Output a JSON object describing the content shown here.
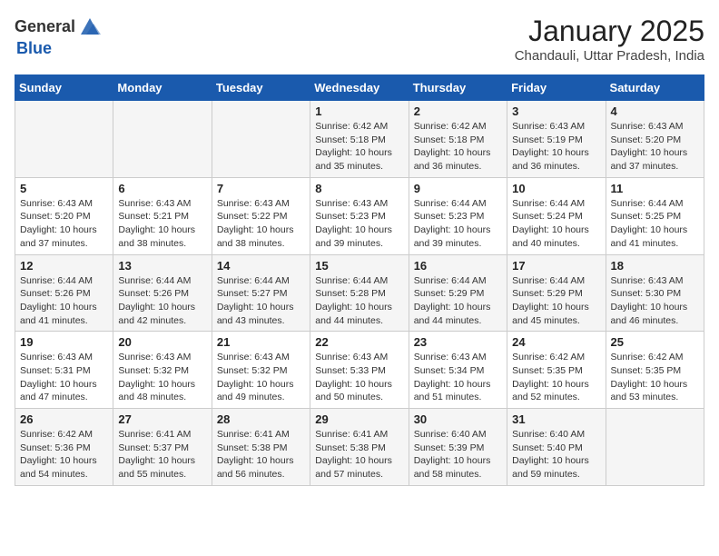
{
  "header": {
    "logo_general": "General",
    "logo_blue": "Blue",
    "month_title": "January 2025",
    "location": "Chandauli, Uttar Pradesh, India"
  },
  "days_of_week": [
    "Sunday",
    "Monday",
    "Tuesday",
    "Wednesday",
    "Thursday",
    "Friday",
    "Saturday"
  ],
  "weeks": [
    [
      {
        "day": "",
        "info": ""
      },
      {
        "day": "",
        "info": ""
      },
      {
        "day": "",
        "info": ""
      },
      {
        "day": "1",
        "info": "Sunrise: 6:42 AM\nSunset: 5:18 PM\nDaylight: 10 hours\nand 35 minutes."
      },
      {
        "day": "2",
        "info": "Sunrise: 6:42 AM\nSunset: 5:18 PM\nDaylight: 10 hours\nand 36 minutes."
      },
      {
        "day": "3",
        "info": "Sunrise: 6:43 AM\nSunset: 5:19 PM\nDaylight: 10 hours\nand 36 minutes."
      },
      {
        "day": "4",
        "info": "Sunrise: 6:43 AM\nSunset: 5:20 PM\nDaylight: 10 hours\nand 37 minutes."
      }
    ],
    [
      {
        "day": "5",
        "info": "Sunrise: 6:43 AM\nSunset: 5:20 PM\nDaylight: 10 hours\nand 37 minutes."
      },
      {
        "day": "6",
        "info": "Sunrise: 6:43 AM\nSunset: 5:21 PM\nDaylight: 10 hours\nand 38 minutes."
      },
      {
        "day": "7",
        "info": "Sunrise: 6:43 AM\nSunset: 5:22 PM\nDaylight: 10 hours\nand 38 minutes."
      },
      {
        "day": "8",
        "info": "Sunrise: 6:43 AM\nSunset: 5:23 PM\nDaylight: 10 hours\nand 39 minutes."
      },
      {
        "day": "9",
        "info": "Sunrise: 6:44 AM\nSunset: 5:23 PM\nDaylight: 10 hours\nand 39 minutes."
      },
      {
        "day": "10",
        "info": "Sunrise: 6:44 AM\nSunset: 5:24 PM\nDaylight: 10 hours\nand 40 minutes."
      },
      {
        "day": "11",
        "info": "Sunrise: 6:44 AM\nSunset: 5:25 PM\nDaylight: 10 hours\nand 41 minutes."
      }
    ],
    [
      {
        "day": "12",
        "info": "Sunrise: 6:44 AM\nSunset: 5:26 PM\nDaylight: 10 hours\nand 41 minutes."
      },
      {
        "day": "13",
        "info": "Sunrise: 6:44 AM\nSunset: 5:26 PM\nDaylight: 10 hours\nand 42 minutes."
      },
      {
        "day": "14",
        "info": "Sunrise: 6:44 AM\nSunset: 5:27 PM\nDaylight: 10 hours\nand 43 minutes."
      },
      {
        "day": "15",
        "info": "Sunrise: 6:44 AM\nSunset: 5:28 PM\nDaylight: 10 hours\nand 44 minutes."
      },
      {
        "day": "16",
        "info": "Sunrise: 6:44 AM\nSunset: 5:29 PM\nDaylight: 10 hours\nand 44 minutes."
      },
      {
        "day": "17",
        "info": "Sunrise: 6:44 AM\nSunset: 5:29 PM\nDaylight: 10 hours\nand 45 minutes."
      },
      {
        "day": "18",
        "info": "Sunrise: 6:43 AM\nSunset: 5:30 PM\nDaylight: 10 hours\nand 46 minutes."
      }
    ],
    [
      {
        "day": "19",
        "info": "Sunrise: 6:43 AM\nSunset: 5:31 PM\nDaylight: 10 hours\nand 47 minutes."
      },
      {
        "day": "20",
        "info": "Sunrise: 6:43 AM\nSunset: 5:32 PM\nDaylight: 10 hours\nand 48 minutes."
      },
      {
        "day": "21",
        "info": "Sunrise: 6:43 AM\nSunset: 5:32 PM\nDaylight: 10 hours\nand 49 minutes."
      },
      {
        "day": "22",
        "info": "Sunrise: 6:43 AM\nSunset: 5:33 PM\nDaylight: 10 hours\nand 50 minutes."
      },
      {
        "day": "23",
        "info": "Sunrise: 6:43 AM\nSunset: 5:34 PM\nDaylight: 10 hours\nand 51 minutes."
      },
      {
        "day": "24",
        "info": "Sunrise: 6:42 AM\nSunset: 5:35 PM\nDaylight: 10 hours\nand 52 minutes."
      },
      {
        "day": "25",
        "info": "Sunrise: 6:42 AM\nSunset: 5:35 PM\nDaylight: 10 hours\nand 53 minutes."
      }
    ],
    [
      {
        "day": "26",
        "info": "Sunrise: 6:42 AM\nSunset: 5:36 PM\nDaylight: 10 hours\nand 54 minutes."
      },
      {
        "day": "27",
        "info": "Sunrise: 6:41 AM\nSunset: 5:37 PM\nDaylight: 10 hours\nand 55 minutes."
      },
      {
        "day": "28",
        "info": "Sunrise: 6:41 AM\nSunset: 5:38 PM\nDaylight: 10 hours\nand 56 minutes."
      },
      {
        "day": "29",
        "info": "Sunrise: 6:41 AM\nSunset: 5:38 PM\nDaylight: 10 hours\nand 57 minutes."
      },
      {
        "day": "30",
        "info": "Sunrise: 6:40 AM\nSunset: 5:39 PM\nDaylight: 10 hours\nand 58 minutes."
      },
      {
        "day": "31",
        "info": "Sunrise: 6:40 AM\nSunset: 5:40 PM\nDaylight: 10 hours\nand 59 minutes."
      },
      {
        "day": "",
        "info": ""
      }
    ]
  ]
}
